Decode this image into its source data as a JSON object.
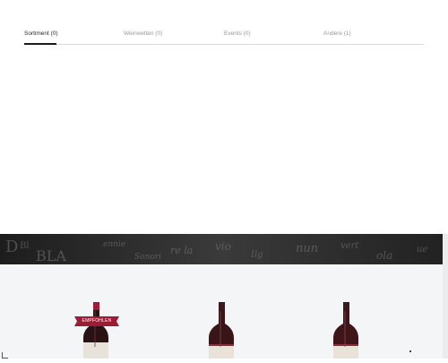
{
  "tabs": [
    {
      "label": "Sortiment (0)",
      "active": true
    },
    {
      "label": "Weinwelten (0)",
      "active": false
    },
    {
      "label": "Events (0)",
      "active": false
    },
    {
      "label": "Andere (1)",
      "active": false
    }
  ],
  "banner": {
    "image": "newsprint-texture-banner"
  },
  "products": [
    {
      "image": "red-wine-bottle",
      "badge": "EMPFOHLEN"
    },
    {
      "image": "red-wine-bottle"
    },
    {
      "image": "red-wine-bottle"
    }
  ],
  "colors": {
    "accent_badge": "#9d1d36",
    "tab_active": "#1a1a1a",
    "products_bg": "#f4f5f6"
  }
}
